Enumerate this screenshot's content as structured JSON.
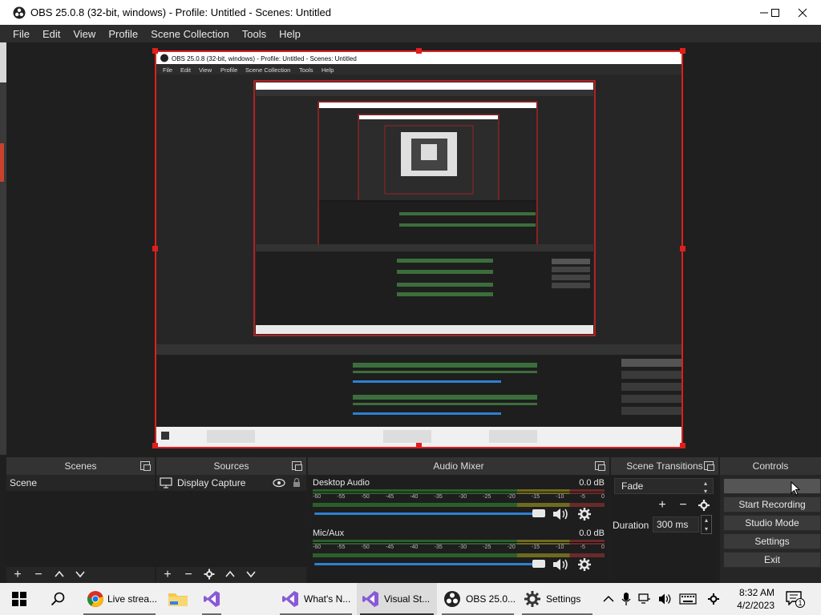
{
  "window": {
    "title": "OBS 25.0.8 (32-bit, windows) - Profile: Untitled - Scenes: Untitled"
  },
  "menu": [
    "File",
    "Edit",
    "View",
    "Profile",
    "Scene Collection",
    "Tools",
    "Help"
  ],
  "preview": {
    "inner_title": "OBS 25.0.8 (32-bit, windows) - Profile: Untitled - Scenes: Untitled",
    "inner_menu": [
      "File",
      "Edit",
      "View",
      "Profile",
      "Scene Collection",
      "Tools",
      "Help"
    ]
  },
  "docks": {
    "scenes": {
      "title": "Scenes",
      "items": [
        "Scene"
      ]
    },
    "sources": {
      "title": "Sources",
      "items": [
        "Display Capture"
      ]
    },
    "mixer": {
      "title": "Audio Mixer",
      "ticks": [
        "-60",
        "-55",
        "-50",
        "-45",
        "-40",
        "-35",
        "-30",
        "-25",
        "-20",
        "-15",
        "-10",
        "-5",
        "0"
      ],
      "channels": [
        {
          "name": "Desktop Audio",
          "level": "0.0 dB"
        },
        {
          "name": "Mic/Aux",
          "level": "0.0 dB"
        }
      ]
    },
    "transitions": {
      "title": "Scene Transitions",
      "selected": "Fade",
      "duration_label": "Duration",
      "duration_value": "300 ms"
    },
    "controls": {
      "title": "Controls",
      "buttons": [
        "",
        "Start Recording",
        "Studio Mode",
        "Settings",
        "Exit"
      ]
    }
  },
  "taskbar": {
    "items": [
      {
        "label": "Live strea..."
      },
      {
        "label": "What's N..."
      },
      {
        "label": "Visual St..."
      },
      {
        "label": "OBS 25.0..."
      },
      {
        "label": "Settings"
      }
    ],
    "time": "8:32 AM",
    "date": "4/2/2023",
    "notification_count": "1"
  },
  "colors": {
    "accent_red": "#e01e1e",
    "slider_blue": "#2e80d0"
  }
}
